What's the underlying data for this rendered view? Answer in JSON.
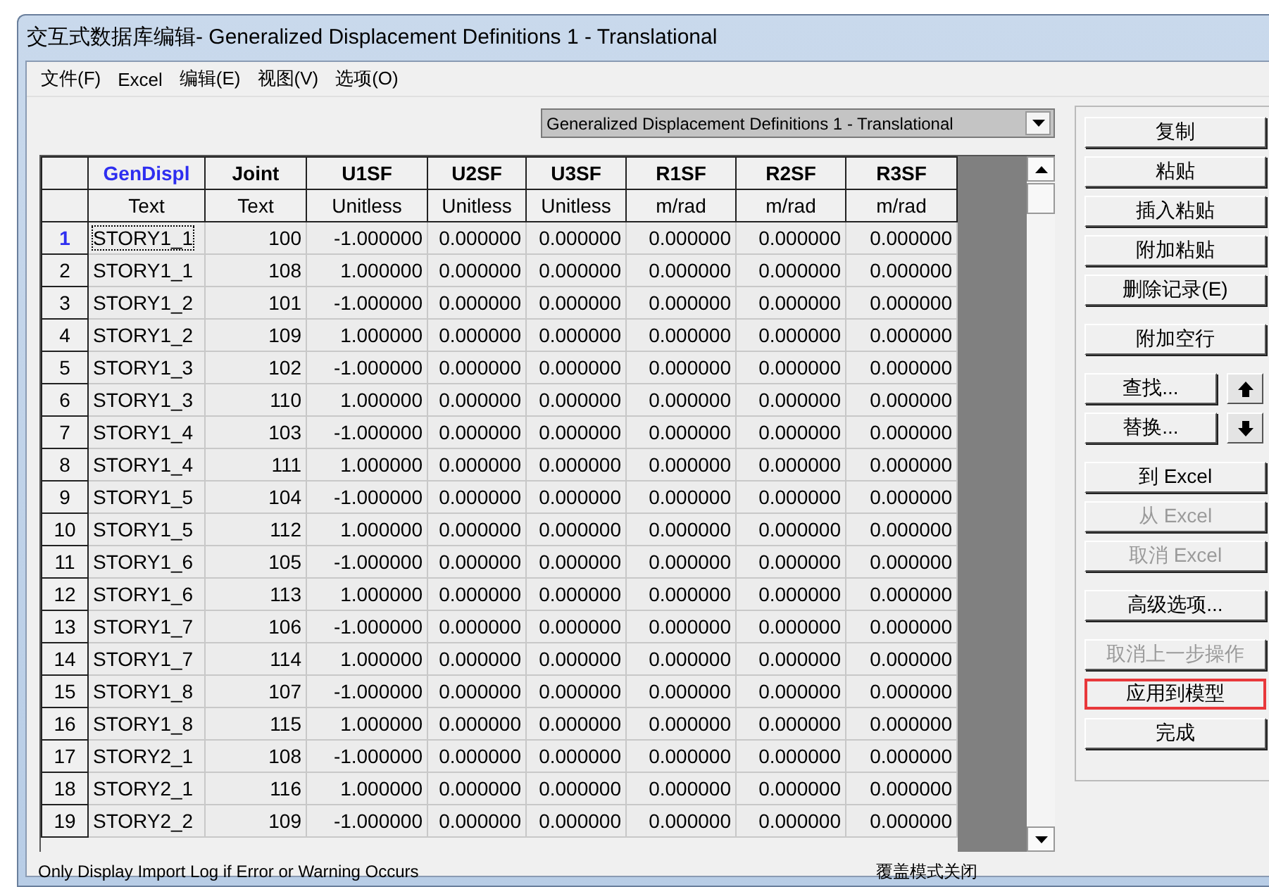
{
  "window": {
    "title": "交互式数据库编辑- Generalized Displacement Definitions 1 - Translational"
  },
  "menu": [
    "文件(F)",
    "Excel",
    "编辑(E)",
    "视图(V)",
    "选项(O)"
  ],
  "table_selector": {
    "value": "Generalized Displacement Definitions 1 - Translational"
  },
  "table": {
    "columns": [
      {
        "name": "GenDispl",
        "unit": "Text",
        "key": true
      },
      {
        "name": "Joint",
        "unit": "Text",
        "key": false
      },
      {
        "name": "U1SF",
        "unit": "Unitless",
        "key": false
      },
      {
        "name": "U2SF",
        "unit": "Unitless",
        "key": false
      },
      {
        "name": "U3SF",
        "unit": "Unitless",
        "key": false
      },
      {
        "name": "R1SF",
        "unit": "m/rad",
        "key": false
      },
      {
        "name": "R2SF",
        "unit": "m/rad",
        "key": false
      },
      {
        "name": "R3SF",
        "unit": "m/rad",
        "key": false
      }
    ],
    "rows": [
      {
        "number": "1",
        "selected": true,
        "cells": [
          "STORY1_1",
          "100",
          "-1.000000",
          "0.000000",
          "0.000000",
          "0.000000",
          "0.000000",
          "0.000000"
        ]
      },
      {
        "number": "2",
        "selected": false,
        "cells": [
          "STORY1_1",
          "108",
          "1.000000",
          "0.000000",
          "0.000000",
          "0.000000",
          "0.000000",
          "0.000000"
        ]
      },
      {
        "number": "3",
        "selected": false,
        "cells": [
          "STORY1_2",
          "101",
          "-1.000000",
          "0.000000",
          "0.000000",
          "0.000000",
          "0.000000",
          "0.000000"
        ]
      },
      {
        "number": "4",
        "selected": false,
        "cells": [
          "STORY1_2",
          "109",
          "1.000000",
          "0.000000",
          "0.000000",
          "0.000000",
          "0.000000",
          "0.000000"
        ]
      },
      {
        "number": "5",
        "selected": false,
        "cells": [
          "STORY1_3",
          "102",
          "-1.000000",
          "0.000000",
          "0.000000",
          "0.000000",
          "0.000000",
          "0.000000"
        ]
      },
      {
        "number": "6",
        "selected": false,
        "cells": [
          "STORY1_3",
          "110",
          "1.000000",
          "0.000000",
          "0.000000",
          "0.000000",
          "0.000000",
          "0.000000"
        ]
      },
      {
        "number": "7",
        "selected": false,
        "cells": [
          "STORY1_4",
          "103",
          "-1.000000",
          "0.000000",
          "0.000000",
          "0.000000",
          "0.000000",
          "0.000000"
        ]
      },
      {
        "number": "8",
        "selected": false,
        "cells": [
          "STORY1_4",
          "111",
          "1.000000",
          "0.000000",
          "0.000000",
          "0.000000",
          "0.000000",
          "0.000000"
        ]
      },
      {
        "number": "9",
        "selected": false,
        "cells": [
          "STORY1_5",
          "104",
          "-1.000000",
          "0.000000",
          "0.000000",
          "0.000000",
          "0.000000",
          "0.000000"
        ]
      },
      {
        "number": "10",
        "selected": false,
        "cells": [
          "STORY1_5",
          "112",
          "1.000000",
          "0.000000",
          "0.000000",
          "0.000000",
          "0.000000",
          "0.000000"
        ]
      },
      {
        "number": "11",
        "selected": false,
        "cells": [
          "STORY1_6",
          "105",
          "-1.000000",
          "0.000000",
          "0.000000",
          "0.000000",
          "0.000000",
          "0.000000"
        ]
      },
      {
        "number": "12",
        "selected": false,
        "cells": [
          "STORY1_6",
          "113",
          "1.000000",
          "0.000000",
          "0.000000",
          "0.000000",
          "0.000000",
          "0.000000"
        ]
      },
      {
        "number": "13",
        "selected": false,
        "cells": [
          "STORY1_7",
          "106",
          "-1.000000",
          "0.000000",
          "0.000000",
          "0.000000",
          "0.000000",
          "0.000000"
        ]
      },
      {
        "number": "14",
        "selected": false,
        "cells": [
          "STORY1_7",
          "114",
          "1.000000",
          "0.000000",
          "0.000000",
          "0.000000",
          "0.000000",
          "0.000000"
        ]
      },
      {
        "number": "15",
        "selected": false,
        "cells": [
          "STORY1_8",
          "107",
          "-1.000000",
          "0.000000",
          "0.000000",
          "0.000000",
          "0.000000",
          "0.000000"
        ]
      },
      {
        "number": "16",
        "selected": false,
        "cells": [
          "STORY1_8",
          "115",
          "1.000000",
          "0.000000",
          "0.000000",
          "0.000000",
          "0.000000",
          "0.000000"
        ]
      },
      {
        "number": "17",
        "selected": false,
        "cells": [
          "STORY2_1",
          "108",
          "-1.000000",
          "0.000000",
          "0.000000",
          "0.000000",
          "0.000000",
          "0.000000"
        ]
      },
      {
        "number": "18",
        "selected": false,
        "cells": [
          "STORY2_1",
          "116",
          "1.000000",
          "0.000000",
          "0.000000",
          "0.000000",
          "0.000000",
          "0.000000"
        ]
      },
      {
        "number": "19",
        "selected": false,
        "cells": [
          "STORY2_2",
          "109",
          "-1.000000",
          "0.000000",
          "0.000000",
          "0.000000",
          "0.000000",
          "0.000000"
        ]
      }
    ]
  },
  "button_groups": [
    [
      {
        "label": "复制",
        "disabled": false,
        "highlighted": false
      },
      {
        "label": "粘贴",
        "disabled": false,
        "highlighted": false
      },
      {
        "label": "插入粘贴",
        "disabled": false,
        "highlighted": false
      },
      {
        "label": "附加粘贴",
        "disabled": false,
        "highlighted": false
      },
      {
        "label": "删除记录(E)",
        "disabled": false,
        "highlighted": false
      }
    ],
    [
      {
        "label": "附加空行",
        "disabled": false,
        "highlighted": false
      }
    ],
    [
      {
        "label": "查找...",
        "disabled": false,
        "highlighted": false,
        "kind": "up"
      },
      {
        "label": "替换...",
        "disabled": false,
        "highlighted": false,
        "kind": "down"
      }
    ],
    [
      {
        "label": "到 Excel",
        "disabled": false,
        "highlighted": false
      },
      {
        "label": "从 Excel",
        "disabled": true,
        "highlighted": false
      },
      {
        "label": "取消 Excel",
        "disabled": true,
        "highlighted": false
      }
    ],
    [
      {
        "label": "高级选项...",
        "disabled": false,
        "highlighted": false
      }
    ],
    [
      {
        "label": "取消上一步操作",
        "disabled": true,
        "highlighted": false
      },
      {
        "label": "应用到模型",
        "disabled": false,
        "highlighted": true
      },
      {
        "label": "完成",
        "disabled": false,
        "highlighted": false
      }
    ]
  ],
  "status_bar": {
    "message": "Only Display Import Log if Error or Warning Occurs",
    "mode": "覆盖模式关闭"
  }
}
